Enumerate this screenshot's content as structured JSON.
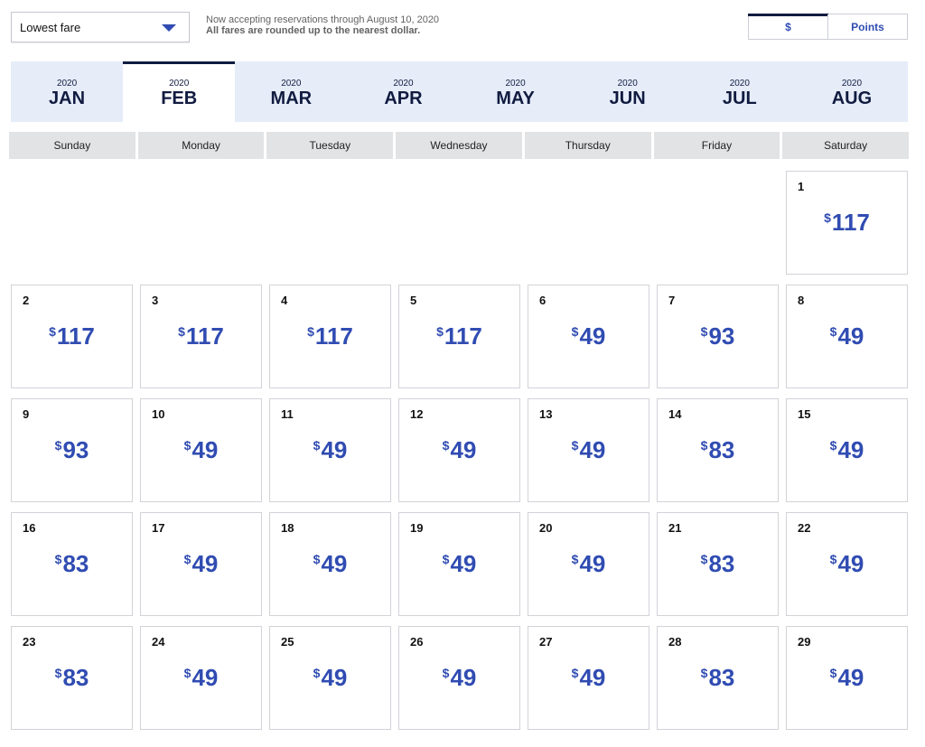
{
  "controls": {
    "fare_type": "Lowest fare",
    "notice_line1": "Now accepting reservations through August 10, 2020",
    "notice_line2": "All fares are rounded up to the nearest dollar.",
    "currency_toggle": [
      {
        "label": "$",
        "active": true
      },
      {
        "label": "Points",
        "active": false
      }
    ]
  },
  "months": [
    {
      "year": "2020",
      "label": "JAN",
      "active": false
    },
    {
      "year": "2020",
      "label": "FEB",
      "active": true
    },
    {
      "year": "2020",
      "label": "MAR",
      "active": false
    },
    {
      "year": "2020",
      "label": "APR",
      "active": false
    },
    {
      "year": "2020",
      "label": "MAY",
      "active": false
    },
    {
      "year": "2020",
      "label": "JUN",
      "active": false
    },
    {
      "year": "2020",
      "label": "JUL",
      "active": false
    },
    {
      "year": "2020",
      "label": "AUG",
      "active": false
    }
  ],
  "weekdays": [
    "Sunday",
    "Monday",
    "Tuesday",
    "Wednesday",
    "Thursday",
    "Friday",
    "Saturday"
  ],
  "calendar": {
    "currency_symbol": "$",
    "first_weekday_index": 6,
    "days": [
      {
        "day": "1",
        "fare": "117"
      },
      {
        "day": "2",
        "fare": "117"
      },
      {
        "day": "3",
        "fare": "117"
      },
      {
        "day": "4",
        "fare": "117"
      },
      {
        "day": "5",
        "fare": "117"
      },
      {
        "day": "6",
        "fare": "49"
      },
      {
        "day": "7",
        "fare": "93"
      },
      {
        "day": "8",
        "fare": "49"
      },
      {
        "day": "9",
        "fare": "93"
      },
      {
        "day": "10",
        "fare": "49"
      },
      {
        "day": "11",
        "fare": "49"
      },
      {
        "day": "12",
        "fare": "49"
      },
      {
        "day": "13",
        "fare": "49"
      },
      {
        "day": "14",
        "fare": "83"
      },
      {
        "day": "15",
        "fare": "49"
      },
      {
        "day": "16",
        "fare": "83"
      },
      {
        "day": "17",
        "fare": "49"
      },
      {
        "day": "18",
        "fare": "49"
      },
      {
        "day": "19",
        "fare": "49"
      },
      {
        "day": "20",
        "fare": "49"
      },
      {
        "day": "21",
        "fare": "83"
      },
      {
        "day": "22",
        "fare": "49"
      },
      {
        "day": "23",
        "fare": "83"
      },
      {
        "day": "24",
        "fare": "49"
      },
      {
        "day": "25",
        "fare": "49"
      },
      {
        "day": "26",
        "fare": "49"
      },
      {
        "day": "27",
        "fare": "49"
      },
      {
        "day": "28",
        "fare": "83"
      },
      {
        "day": "29",
        "fare": "49"
      }
    ]
  }
}
